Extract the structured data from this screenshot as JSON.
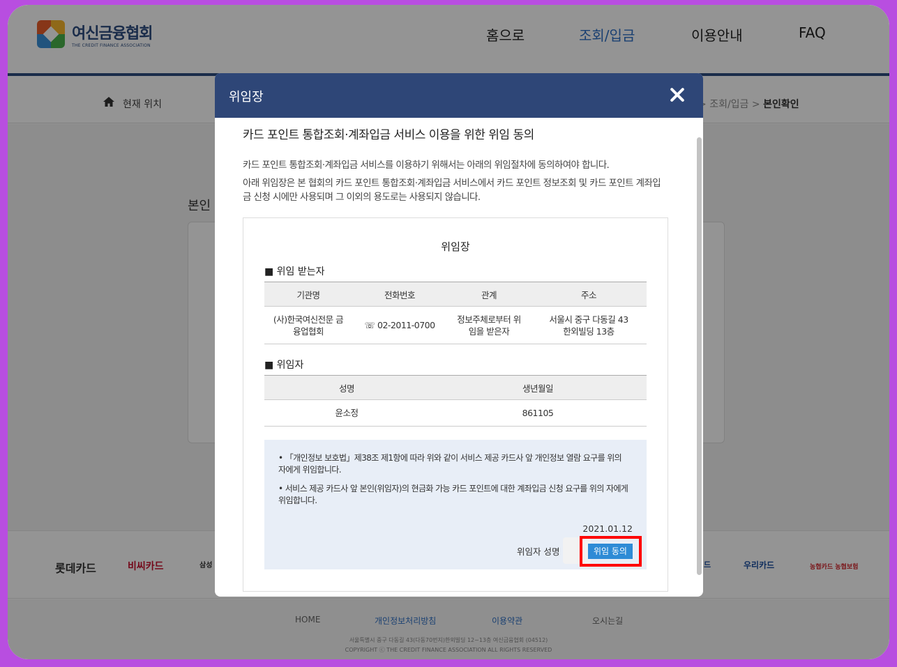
{
  "header": {
    "logo_name": "여신금융협회",
    "logo_sub": "THE CREDIT FINANCE ASSOCIATION",
    "nav": [
      "홈으로",
      "조회/입금",
      "이용안내",
      "FAQ"
    ],
    "active_nav": "조회/입금"
  },
  "location": {
    "label": "현재 위치",
    "path_mid": "조회/입금",
    "path_current": "본인확인",
    "separator": ">"
  },
  "page": {
    "identity_title": "본인"
  },
  "cards": [
    "롯데카드",
    "비씨카드",
    "삼성",
    "드",
    "우리카드",
    "농협카드 농협보험"
  ],
  "footer": {
    "links": [
      "HOME",
      "개인정보처리방침",
      "이용약관",
      "오시는길"
    ],
    "address": "서울특별시 중구 다동길 43(다동70번지)한외빌딩 12~13층 여신금융협회 (04512)",
    "copyright": "COPYRIGHT ⓒ THE CREDIT FINANCE ASSOCIATION ALL RIGHTS RESERVED"
  },
  "modal": {
    "title": "위임장",
    "heading": "카드 포인트 통합조회·계좌입금 서비스 이용을 위한 위임 동의",
    "p1": "카드 포인트 통합조회·계좌입금 서비스를 이용하기 위해서는 아래의 위임절차에 동의하여야 합니다.",
    "p2": "아래 위임장은 본 협회의 카드 포인트 통합조회·계좌입금 서비스에서 카드 포인트 정보조회 및 카드 포인트 계좌입금 신청 시에만 사용되며 그 이외의 용도로는 사용되지 않습니다.",
    "doc": {
      "title": "위임장",
      "recipient_label": "■ 위임 받는자",
      "recipient_headers": [
        "기관명",
        "전화번호",
        "관계",
        "주소"
      ],
      "recipient_row": [
        "(사)한국여신전문 금융업협회",
        "☏ 02-2011-0700",
        "정보주체로부터 위임을 받은자",
        "서울시 중구 다동길 43 한외빌딩 13층"
      ],
      "delegator_label": "■ 위임자",
      "delegator_headers": [
        "성명",
        "생년월일"
      ],
      "delegator_row": [
        "윤소정",
        "861105"
      ],
      "notice1": "• 「개인정보 보호법」제38조 제1항에 따라 위와 같이 서비스 제공 카드사 앞 개인정보 열람 요구를 위의 자에게 위임합니다.",
      "notice2": "• 서비스 제공 카드사 앞 본인(위임자)의 현금화 가능 카드 포인트에 대한 계좌입금 신청 요구를 위의 자에게 위임합니다.",
      "date": "2021.01.12",
      "sign_label": "위임자 성명",
      "agree_button": "위임 동의"
    }
  },
  "colors": {
    "brand": "#2e4677",
    "accent": "#2e8bd6",
    "highlight": "#ff0000",
    "frame": "#b84ee0"
  }
}
